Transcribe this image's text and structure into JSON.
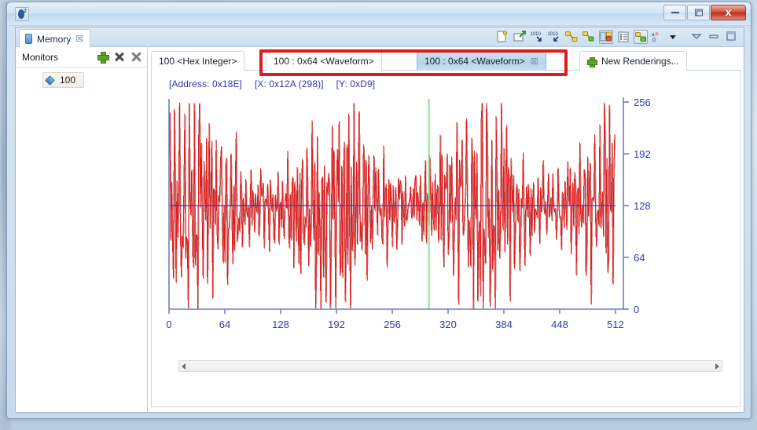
{
  "window": {
    "app_icon": "eclipse-app-icon",
    "buttons": {
      "minimize": "minimize-button",
      "maximize": "maximize-button",
      "close_label": "x"
    }
  },
  "view": {
    "tab_label": "Memory",
    "tab_close_glyph": "☒",
    "toolbar_icons": [
      "new-memory-view-icon",
      "pin-memory-monitor-icon",
      "next-memory-monitor-icon",
      "previous-memory-monitor-icon",
      "link-memory-rendering-panes-icon",
      "sync-memory-rendering-panes-icon",
      "toggle-split-pane-icon",
      "toggle-monitors-pane-icon",
      "toggle-memory-monitors-icon",
      "view-menu-icon",
      "view-menu-arrow-icon",
      "minimize-view-icon",
      "restore-view-icon",
      "maximize-view-icon"
    ]
  },
  "monitors": {
    "title": "Monitors",
    "add_label": "add-memory-monitor",
    "remove_label": "remove-memory-monitor",
    "remove_all_label": "remove-all-memory-monitors",
    "items": [
      {
        "label": "100"
      }
    ]
  },
  "renderings": {
    "tabs": [
      {
        "label": "100 <Hex Integer>",
        "selected": false,
        "closable": false
      },
      {
        "label": "100 : 0x64 <Waveform>",
        "selected": false,
        "closable": false
      },
      {
        "label": "100 : 0x64 <Waveform>",
        "selected": true,
        "closable": true
      }
    ],
    "new_renderings_label": "New Renderings...",
    "tab_close_glyph": "☒",
    "highlight_color": "#e11b1b"
  },
  "status": {
    "address": "[Address: 0x18E]",
    "x": "[X: 0x12A (298)]",
    "y": "[Y: 0xD9]"
  },
  "chart_data": {
    "type": "line",
    "title": "",
    "xlabel": "",
    "ylabel": "",
    "xlim": [
      0,
      512
    ],
    "ylim": [
      0,
      256
    ],
    "xticks": [
      0,
      64,
      128,
      192,
      256,
      320,
      384,
      448,
      512
    ],
    "yticks": [
      0,
      64,
      128,
      192,
      256
    ],
    "grid": false,
    "legend": null,
    "series": [
      {
        "name": "memory-waveform",
        "color": "#e02020",
        "description": "High-frequency byte values read from memory, oscillating across the full 0-255 range with a slow beating envelope",
        "n_points": 512,
        "envelope_mean": 128,
        "envelope_amplitude_range": [
          40,
          128
        ]
      }
    ],
    "markers": [
      {
        "name": "midline",
        "type": "hline",
        "value": 128,
        "color": "#3a3ab0"
      },
      {
        "name": "cursor",
        "type": "vline",
        "value": 298,
        "color": "#86e38a"
      }
    ],
    "axis_color": "#6f7fc0",
    "tick_label_color": "#2f39b8"
  },
  "scrollbar": {
    "left_arrow": "scroll-left-icon",
    "right_arrow": "scroll-right-icon"
  }
}
